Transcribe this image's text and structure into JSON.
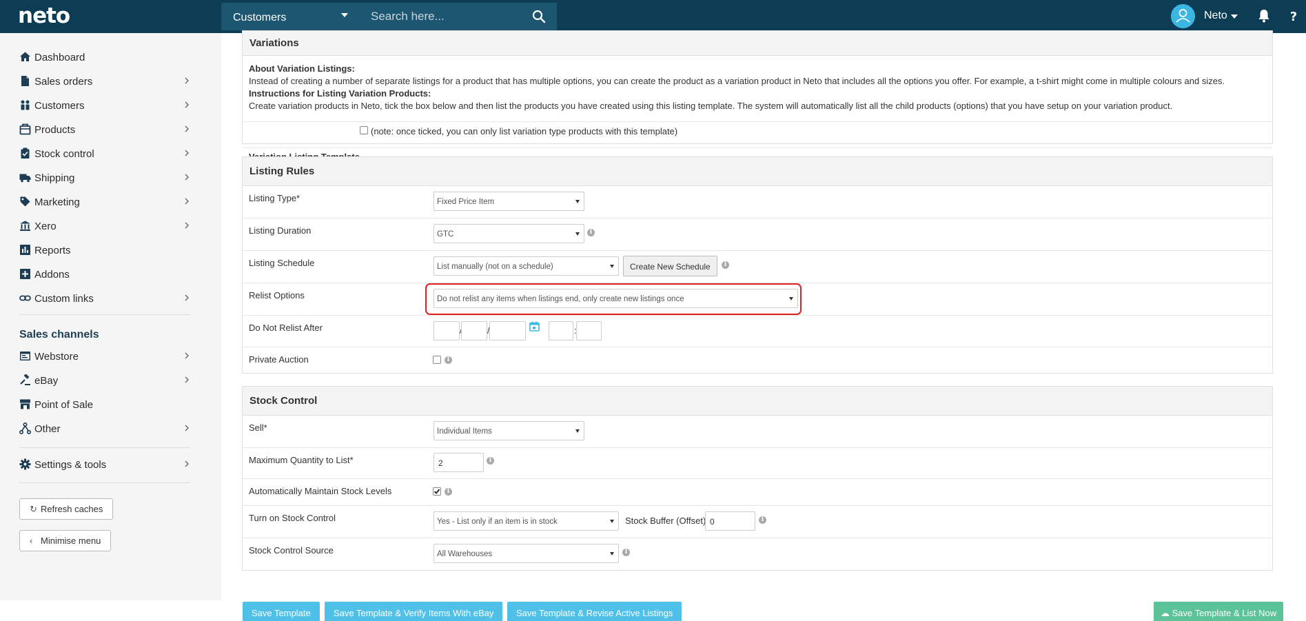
{
  "topbar": {
    "logo": "neto",
    "search_scope": "Customers",
    "search_placeholder": "Search here...",
    "user_name": "Neto"
  },
  "sidebar": {
    "items": [
      {
        "label": "Dashboard",
        "icon": "home-icon"
      },
      {
        "label": "Sales orders",
        "icon": "document-icon"
      },
      {
        "label": "Customers",
        "icon": "people-icon"
      },
      {
        "label": "Products",
        "icon": "box-icon"
      },
      {
        "label": "Stock control",
        "icon": "clipboard-icon"
      },
      {
        "label": "Shipping",
        "icon": "truck-icon"
      },
      {
        "label": "Marketing",
        "icon": "tag-icon"
      },
      {
        "label": "Xero",
        "icon": "bank-icon"
      },
      {
        "label": "Reports",
        "icon": "bar-chart-icon"
      },
      {
        "label": "Addons",
        "icon": "plus-square-icon"
      },
      {
        "label": "Custom links",
        "icon": "link-icon"
      }
    ],
    "channels_heading": "Sales channels",
    "channels": [
      {
        "label": "Webstore",
        "icon": "browser-icon"
      },
      {
        "label": "eBay",
        "icon": "gavel-icon"
      },
      {
        "label": "Point of Sale",
        "icon": "store-icon"
      },
      {
        "label": "Other",
        "icon": "network-icon"
      }
    ],
    "settings_label": "Settings & tools",
    "refresh_label": "Refresh caches",
    "minimise_label": "Minimise menu"
  },
  "variations": {
    "title": "Variations",
    "about_heading": "About Variation Listings:",
    "about_text": "Instead of creating a number of separate listings for a product that has multiple options, you can create the product as a variation product in Neto that includes all the options you offer. For example, a t-shirt might come in multiple colours and sizes.",
    "instructions_heading": "Instructions for Listing Variation Products:",
    "instructions_text": "Create variation products in Neto, tick the box below and then list the products you have created using this listing template. The system will automatically list all the child products (options) that you have setup on your variation product.",
    "template_label": "Variation Listing Template",
    "template_note": "(note: once ticked, you can only list variation type products with this template)"
  },
  "listing_rules": {
    "title": "Listing Rules",
    "listing_type_label": "Listing Type*",
    "listing_type_value": "Fixed Price Item",
    "duration_label": "Listing Duration",
    "duration_value": "GTC",
    "schedule_label": "Listing Schedule",
    "schedule_value": "List manually (not on a schedule)",
    "create_schedule_label": "Create New Schedule",
    "relist_label": "Relist Options",
    "relist_value": "Do not relist any items when listings end, only create new listings once",
    "do_not_relist_label": "Do Not Relist After",
    "date_sep": "/",
    "time_sep": ":",
    "private_auction_label": "Private Auction"
  },
  "stock_control": {
    "title": "Stock Control",
    "sell_label": "Sell*",
    "sell_value": "Individual Items",
    "max_qty_label": "Maximum Quantity to List*",
    "max_qty_value": "2",
    "auto_maintain_label": "Automatically Maintain Stock Levels",
    "turn_on_label": "Turn on Stock Control",
    "turn_on_value": "Yes - List only if an item is in stock",
    "buffer_label": "Stock Buffer (Offset)",
    "buffer_value": "0",
    "source_label": "Stock Control Source",
    "source_value": "All Warehouses"
  },
  "actions": {
    "save_template": "Save Template",
    "save_verify": "Save Template & Verify Items With eBay",
    "save_revise": "Save Template & Revise Active Listings",
    "save_list_now": "Save Template & List Now"
  },
  "colors": {
    "topbar": "#0c3d55",
    "accent": "#4fc1e9",
    "green": "#5cc398",
    "highlight": "#e02020"
  }
}
